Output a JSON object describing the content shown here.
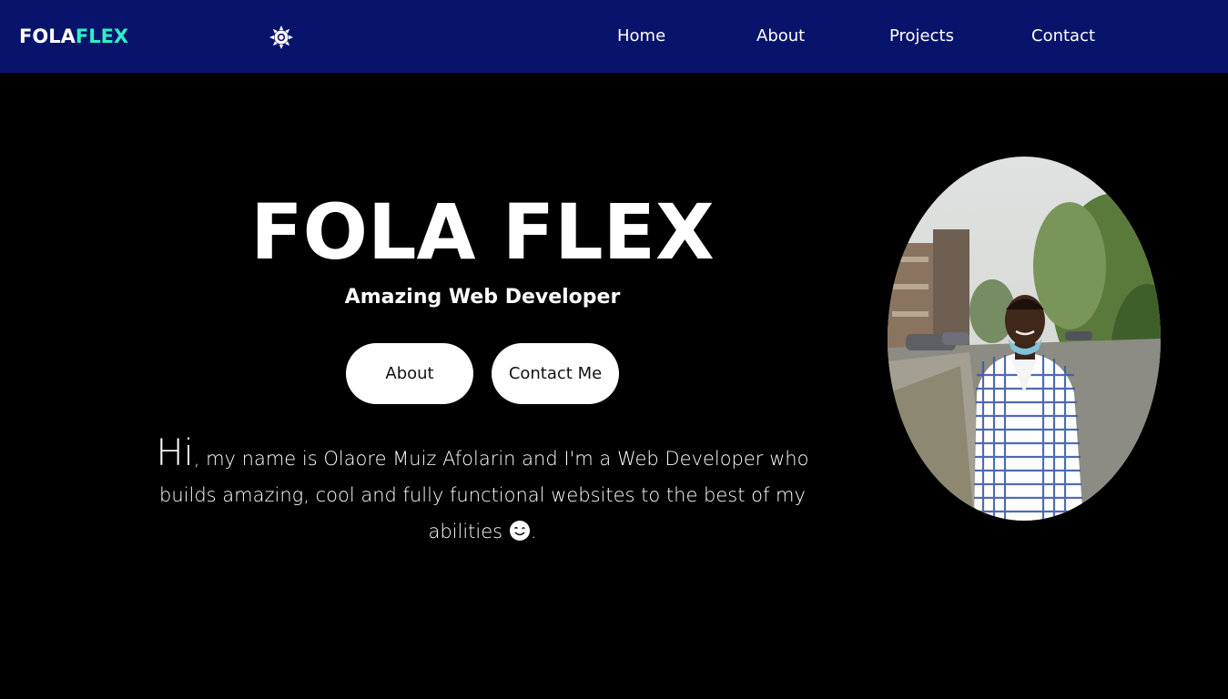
{
  "nav": {
    "logo_part1": "FOLA",
    "logo_part2": "FLEX",
    "theme_icon": "sun-icon",
    "links": [
      "Home",
      "About",
      "Projects",
      "Contact"
    ]
  },
  "hero": {
    "title": "FOLA FLEX",
    "subtitle": "Amazing Web Developer",
    "buttons": {
      "about": "About",
      "contact": "Contact Me"
    },
    "intro": {
      "greeting": "Hi",
      "text": ", my name is Olaore Muiz Afolarin and I'm a Web Developer who builds amazing, cool and fully functional websites to the best of my abilities",
      "end": ".",
      "emoji": "winking-face-icon"
    },
    "portrait": "profile-photo"
  },
  "colors": {
    "nav_bg": "#08146b",
    "page_bg": "#000000",
    "accent": "#2ff0c4",
    "text": "#ffffff",
    "button_bg": "#ffffff"
  }
}
